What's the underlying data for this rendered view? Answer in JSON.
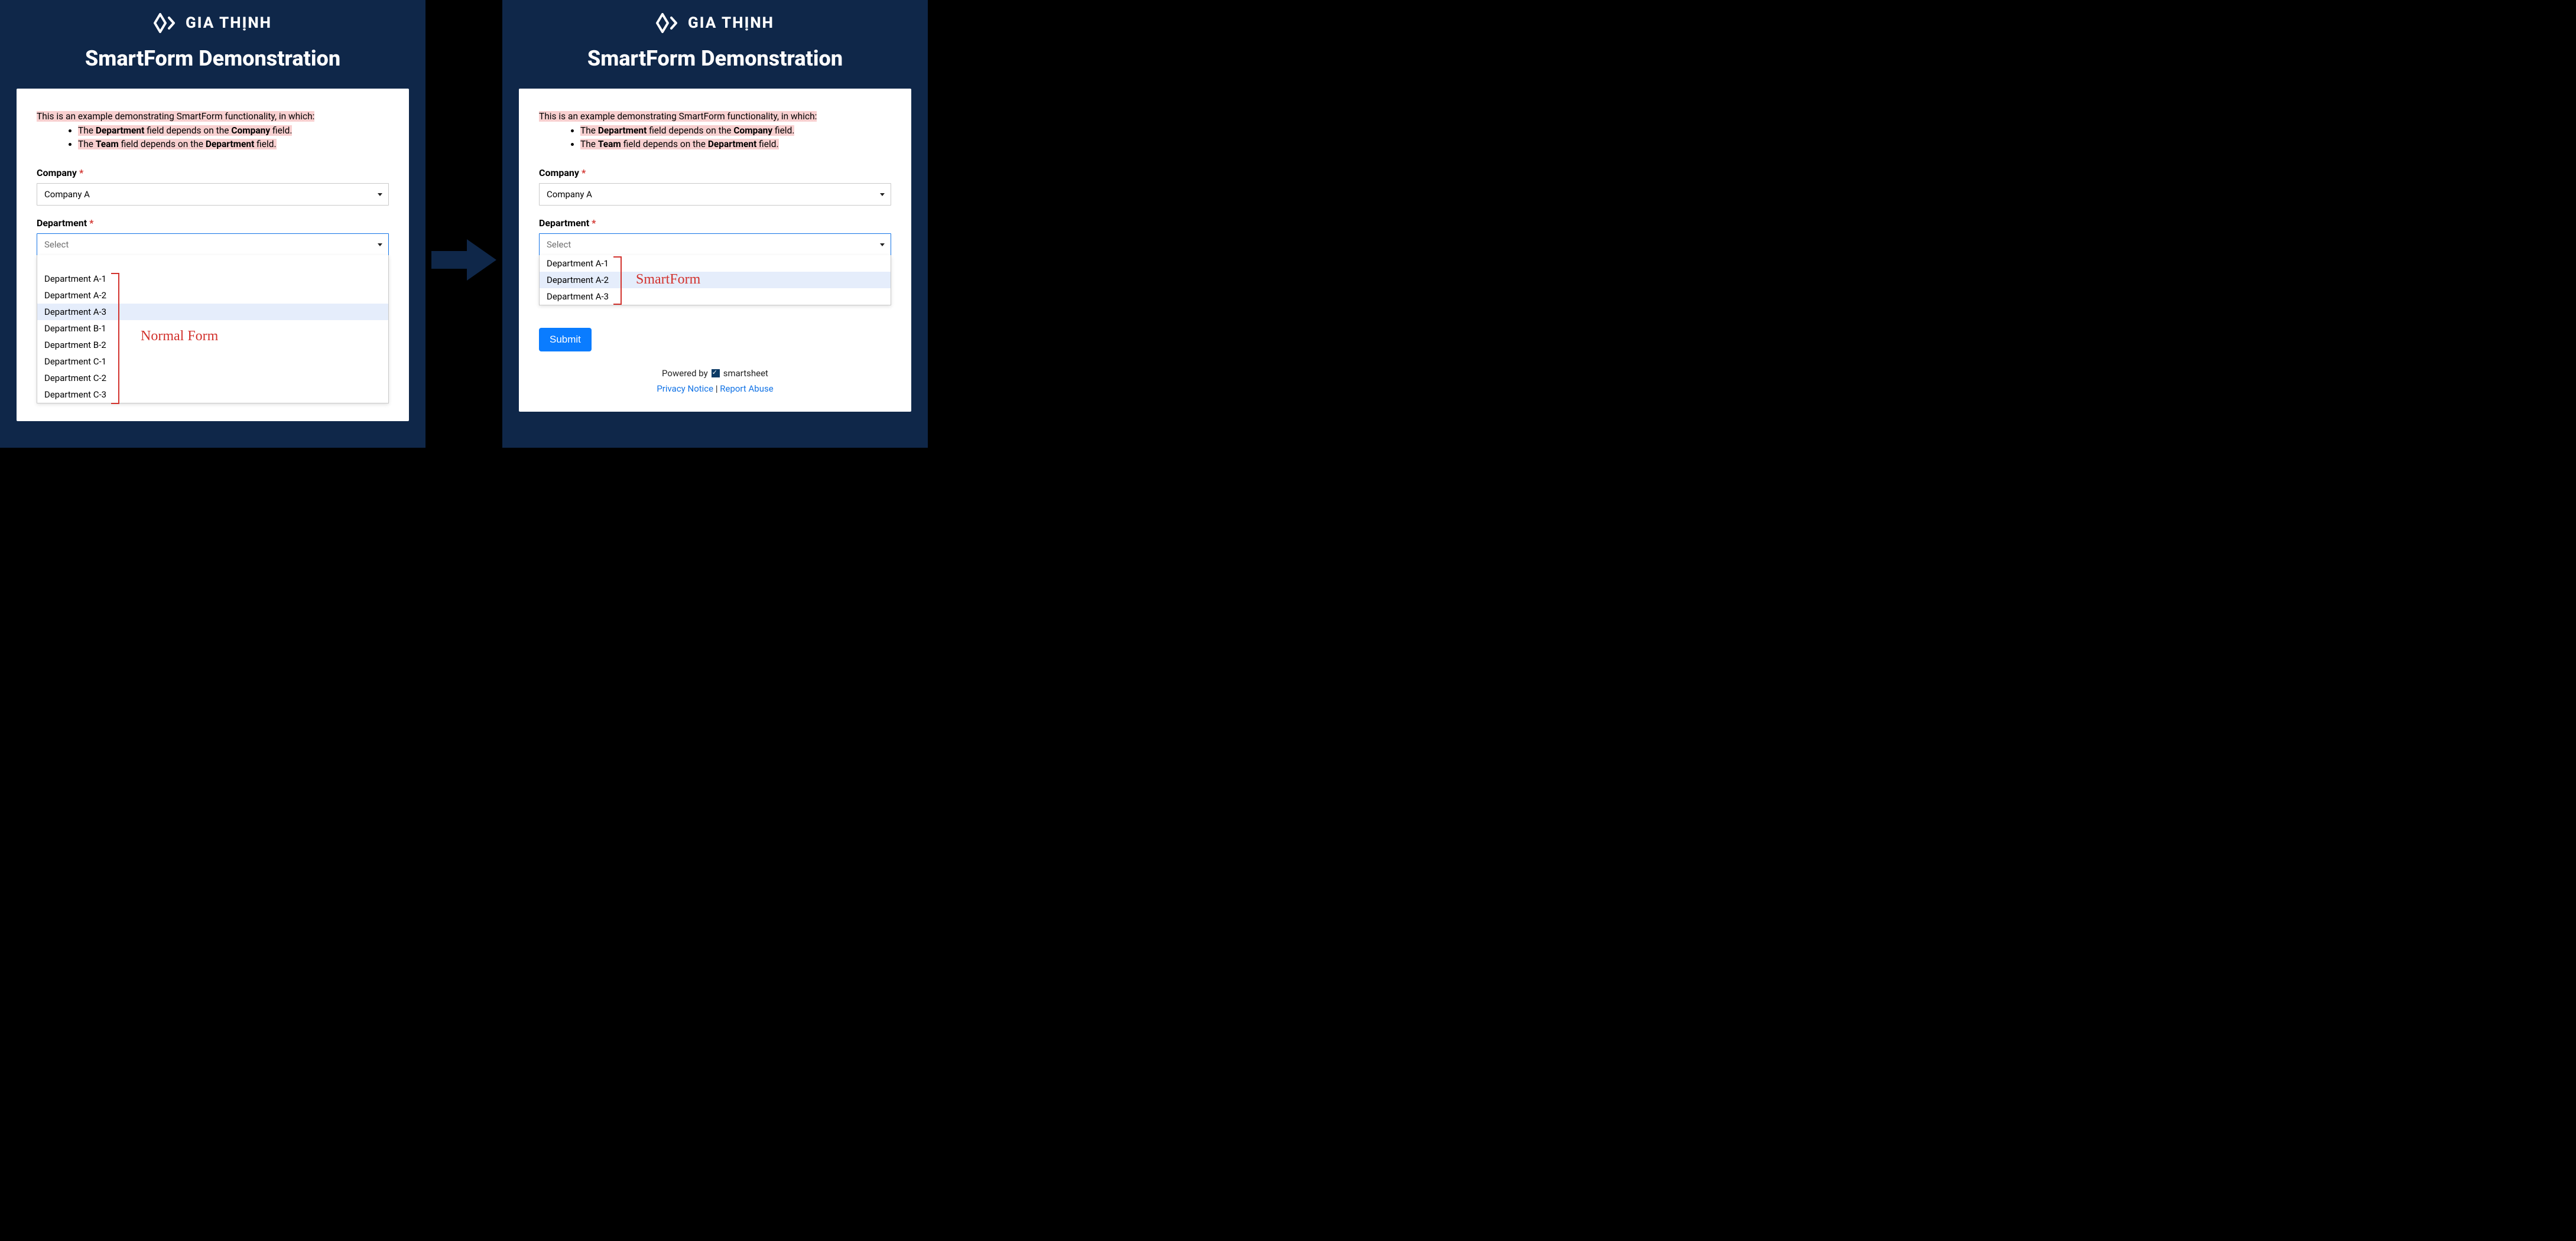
{
  "brand": {
    "name": "GIA THỊNH"
  },
  "pageTitle": "SmartForm Demonstration",
  "intro": {
    "lead": "This is an example demonstrating SmartForm functionality, in which:",
    "li1_pre": "The ",
    "li1_s1": "Department",
    "li1_mid": " field depends on the ",
    "li1_s2": "Company",
    "li1_post": " field.",
    "li2_pre": "The ",
    "li2_s1": "Team",
    "li2_mid": " field depends on the ",
    "li2_s2": "Department",
    "li2_post": " field."
  },
  "labels": {
    "company": "Company",
    "department": "Department",
    "required": "*",
    "selectPlaceholder": "Select",
    "submit": "Submit",
    "poweredBy": "Powered by",
    "smartsheet": "smartsheet",
    "privacy": "Privacy Notice",
    "report": "Report Abuse",
    "sep": "|"
  },
  "left": {
    "companyValue": "Company A",
    "deptOptions": [
      "Department A-1",
      "Department A-2",
      "Department A-3",
      "Department B-1",
      "Department B-2",
      "Department C-1",
      "Department C-2",
      "Department C-3"
    ],
    "hoverIndex": 2,
    "annotation": "Normal Form"
  },
  "right": {
    "companyValue": "Company A",
    "deptOptions": [
      "Department A-1",
      "Department A-2",
      "Department A-3"
    ],
    "hoverIndex": 1,
    "annotation": "SmartForm"
  }
}
